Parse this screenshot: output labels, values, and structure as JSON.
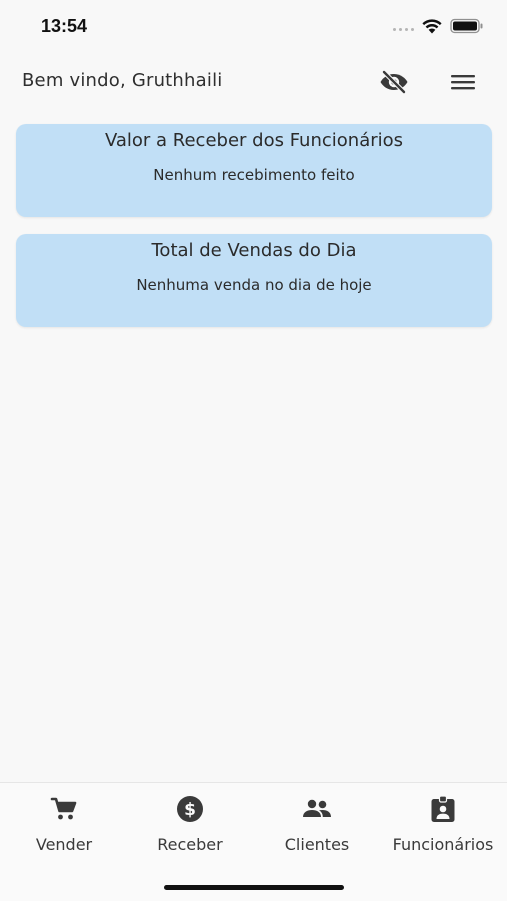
{
  "status_bar": {
    "time": "13:54"
  },
  "header": {
    "title": "Bem vindo, Gruthhaili",
    "icons": [
      "visibility-off-icon",
      "menu-icon"
    ]
  },
  "cards": [
    {
      "title": "Valor a Receber dos Funcionários",
      "subtitle": "Nenhum recebimento feito"
    },
    {
      "title": "Total de Vendas do Dia",
      "subtitle": "Nenhuma venda no dia de hoje"
    }
  ],
  "bottom_nav": {
    "items": [
      {
        "label": "Vender",
        "icon": "cart-icon"
      },
      {
        "label": "Receber",
        "icon": "dollar-circle-icon"
      },
      {
        "label": "Clientes",
        "icon": "people-icon"
      },
      {
        "label": "Funcionários",
        "icon": "id-badge-icon"
      }
    ]
  },
  "colors": {
    "card_background": "#c1dff6",
    "page_background": "#f8f8f8",
    "icon_color": "#3a3a3a"
  }
}
